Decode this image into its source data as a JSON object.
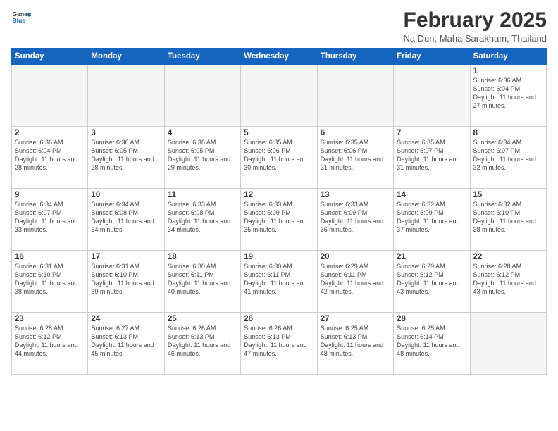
{
  "header": {
    "logo_general": "General",
    "logo_blue": "Blue",
    "month_title": "February 2025",
    "location": "Na Dun, Maha Sarakham, Thailand"
  },
  "calendar": {
    "days_of_week": [
      "Sunday",
      "Monday",
      "Tuesday",
      "Wednesday",
      "Thursday",
      "Friday",
      "Saturday"
    ],
    "weeks": [
      [
        {
          "day": "",
          "empty": true
        },
        {
          "day": "",
          "empty": true
        },
        {
          "day": "",
          "empty": true
        },
        {
          "day": "",
          "empty": true
        },
        {
          "day": "",
          "empty": true
        },
        {
          "day": "",
          "empty": true
        },
        {
          "day": "1",
          "sunrise": "6:36 AM",
          "sunset": "6:04 PM",
          "daylight": "11 hours and 27 minutes."
        }
      ],
      [
        {
          "day": "2",
          "sunrise": "6:36 AM",
          "sunset": "6:04 PM",
          "daylight": "11 hours and 28 minutes."
        },
        {
          "day": "3",
          "sunrise": "6:36 AM",
          "sunset": "6:05 PM",
          "daylight": "11 hours and 28 minutes."
        },
        {
          "day": "4",
          "sunrise": "6:36 AM",
          "sunset": "6:05 PM",
          "daylight": "11 hours and 29 minutes."
        },
        {
          "day": "5",
          "sunrise": "6:35 AM",
          "sunset": "6:06 PM",
          "daylight": "11 hours and 30 minutes."
        },
        {
          "day": "6",
          "sunrise": "6:35 AM",
          "sunset": "6:06 PM",
          "daylight": "11 hours and 31 minutes."
        },
        {
          "day": "7",
          "sunrise": "6:35 AM",
          "sunset": "6:07 PM",
          "daylight": "11 hours and 31 minutes."
        },
        {
          "day": "8",
          "sunrise": "6:34 AM",
          "sunset": "6:07 PM",
          "daylight": "11 hours and 32 minutes."
        }
      ],
      [
        {
          "day": "9",
          "sunrise": "6:34 AM",
          "sunset": "6:07 PM",
          "daylight": "11 hours and 33 minutes."
        },
        {
          "day": "10",
          "sunrise": "6:34 AM",
          "sunset": "6:08 PM",
          "daylight": "11 hours and 34 minutes."
        },
        {
          "day": "11",
          "sunrise": "6:33 AM",
          "sunset": "6:08 PM",
          "daylight": "11 hours and 34 minutes."
        },
        {
          "day": "12",
          "sunrise": "6:33 AM",
          "sunset": "6:09 PM",
          "daylight": "11 hours and 35 minutes."
        },
        {
          "day": "13",
          "sunrise": "6:33 AM",
          "sunset": "6:09 PM",
          "daylight": "11 hours and 36 minutes."
        },
        {
          "day": "14",
          "sunrise": "6:32 AM",
          "sunset": "6:09 PM",
          "daylight": "11 hours and 37 minutes."
        },
        {
          "day": "15",
          "sunrise": "6:32 AM",
          "sunset": "6:10 PM",
          "daylight": "11 hours and 38 minutes."
        }
      ],
      [
        {
          "day": "16",
          "sunrise": "6:31 AM",
          "sunset": "6:10 PM",
          "daylight": "11 hours and 38 minutes."
        },
        {
          "day": "17",
          "sunrise": "6:31 AM",
          "sunset": "6:10 PM",
          "daylight": "11 hours and 39 minutes."
        },
        {
          "day": "18",
          "sunrise": "6:30 AM",
          "sunset": "6:11 PM",
          "daylight": "11 hours and 40 minutes."
        },
        {
          "day": "19",
          "sunrise": "6:30 AM",
          "sunset": "6:11 PM",
          "daylight": "11 hours and 41 minutes."
        },
        {
          "day": "20",
          "sunrise": "6:29 AM",
          "sunset": "6:11 PM",
          "daylight": "11 hours and 42 minutes."
        },
        {
          "day": "21",
          "sunrise": "6:29 AM",
          "sunset": "6:12 PM",
          "daylight": "11 hours and 43 minutes."
        },
        {
          "day": "22",
          "sunrise": "6:28 AM",
          "sunset": "6:12 PM",
          "daylight": "11 hours and 43 minutes."
        }
      ],
      [
        {
          "day": "23",
          "sunrise": "6:28 AM",
          "sunset": "6:12 PM",
          "daylight": "11 hours and 44 minutes."
        },
        {
          "day": "24",
          "sunrise": "6:27 AM",
          "sunset": "6:13 PM",
          "daylight": "11 hours and 45 minutes."
        },
        {
          "day": "25",
          "sunrise": "6:26 AM",
          "sunset": "6:13 PM",
          "daylight": "11 hours and 46 minutes."
        },
        {
          "day": "26",
          "sunrise": "6:26 AM",
          "sunset": "6:13 PM",
          "daylight": "11 hours and 47 minutes."
        },
        {
          "day": "27",
          "sunrise": "6:25 AM",
          "sunset": "6:13 PM",
          "daylight": "11 hours and 48 minutes."
        },
        {
          "day": "28",
          "sunrise": "6:25 AM",
          "sunset": "6:14 PM",
          "daylight": "11 hours and 48 minutes."
        },
        {
          "day": "",
          "empty": true
        }
      ]
    ]
  }
}
